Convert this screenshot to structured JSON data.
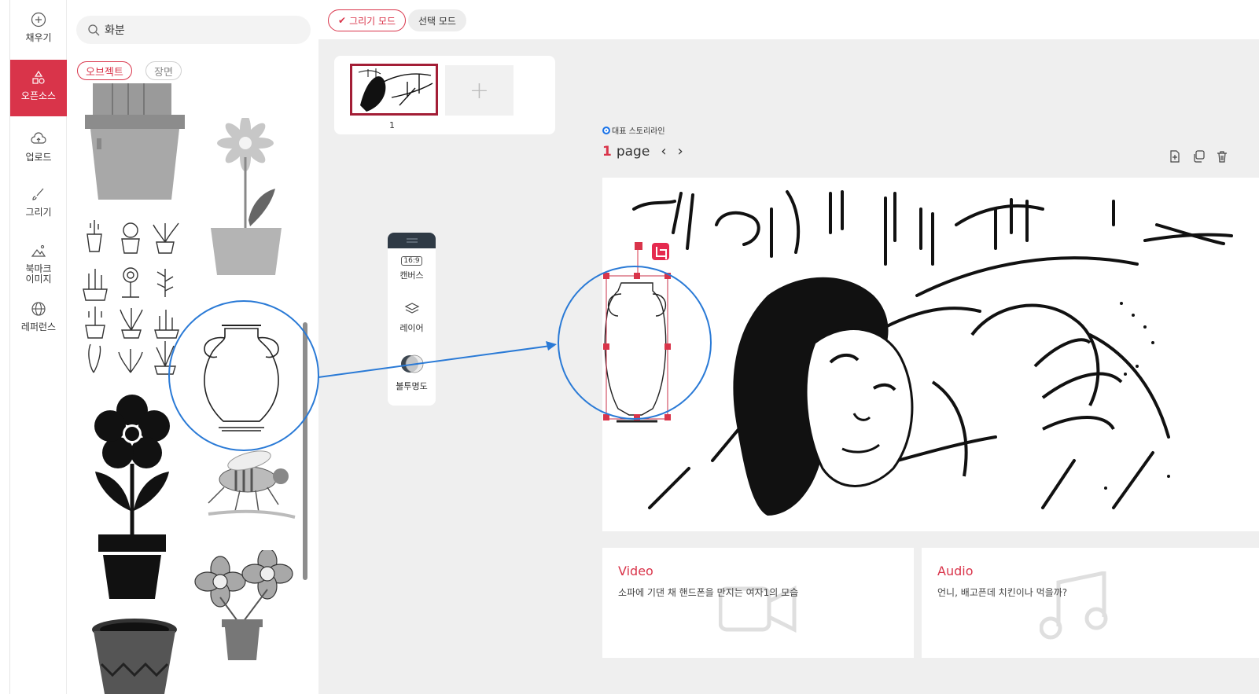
{
  "rail": {
    "items": [
      {
        "label": "채우기",
        "icon": "plus-circle-icon"
      },
      {
        "label": "오픈소스",
        "icon": "shapes-icon",
        "active": true
      },
      {
        "label": "업로드",
        "icon": "upload-cloud-icon"
      },
      {
        "label": "그리기",
        "icon": "brush-icon"
      },
      {
        "label_line1": "북마크",
        "label_line2": "이미지",
        "icon": "bookmark-image-icon"
      },
      {
        "label": "레퍼런스",
        "icon": "globe-icon"
      }
    ]
  },
  "panel": {
    "search_value": "화분",
    "chips": [
      "오브젝트",
      "장면"
    ]
  },
  "topbar": {
    "draw_mode": "그리기 모드",
    "select_mode": "선택 모드"
  },
  "pages": {
    "thumb_number": "1",
    "add_symbol": "+"
  },
  "toolbox": {
    "canvas_ratio": "16:9",
    "canvas_label": "캔버스",
    "layer_label": "레이어",
    "opacity_label": "불투명도"
  },
  "editor": {
    "storyline": "대표 스토리라인",
    "page_num": "1",
    "page_word": "page",
    "prev": "‹",
    "next": "›"
  },
  "cards": {
    "video_title": "Video",
    "video_desc": "소파에 기댄 채 핸드폰을 만지는 여자1의 모습",
    "audio_title": "Audio",
    "audio_desc": "언니, 배고픈데 치킨이나 먹을까?"
  },
  "colors": {
    "accent": "#d9344a",
    "annotation": "#2a7ad6"
  }
}
